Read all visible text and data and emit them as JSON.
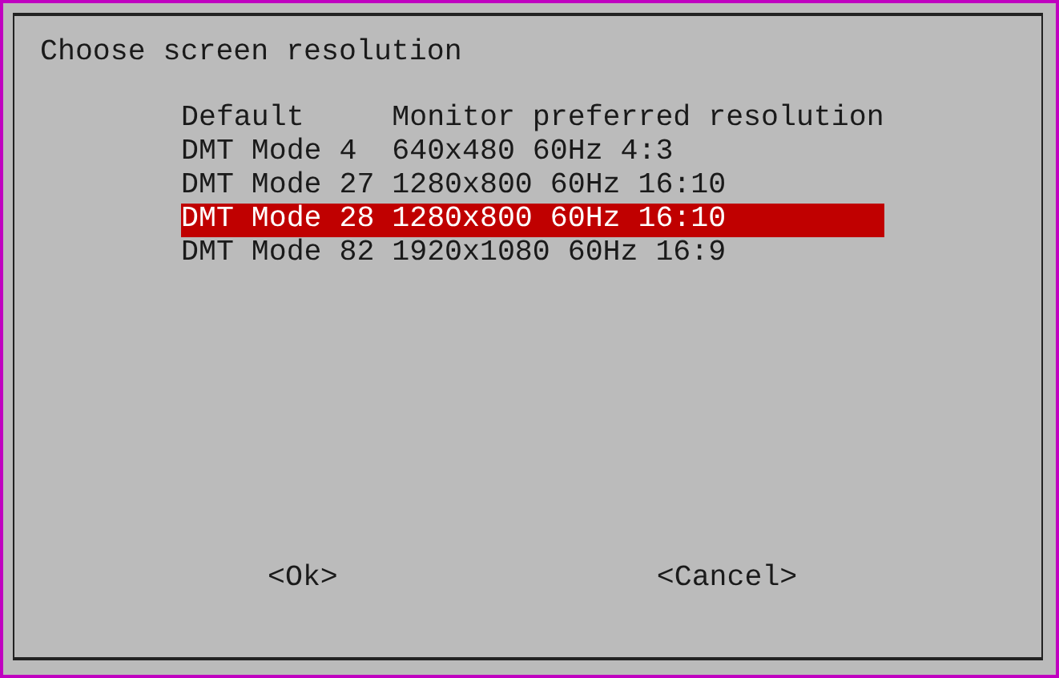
{
  "dialog": {
    "title": "Choose screen resolution",
    "items": [
      {
        "mode": "Default",
        "description": "Monitor preferred resolution",
        "selected": false
      },
      {
        "mode": "DMT Mode 4",
        "description": "640x480 60Hz 4:3",
        "selected": false
      },
      {
        "mode": "DMT Mode 27",
        "description": "1280x800 60Hz 16:10",
        "selected": false
      },
      {
        "mode": "DMT Mode 28",
        "description": "1280x800 60Hz 16:10",
        "selected": true
      },
      {
        "mode": "DMT Mode 82",
        "description": "1920x1080 60Hz 16:9",
        "selected": false
      }
    ],
    "buttons": [
      "<Ok>",
      "<Cancel>"
    ]
  }
}
